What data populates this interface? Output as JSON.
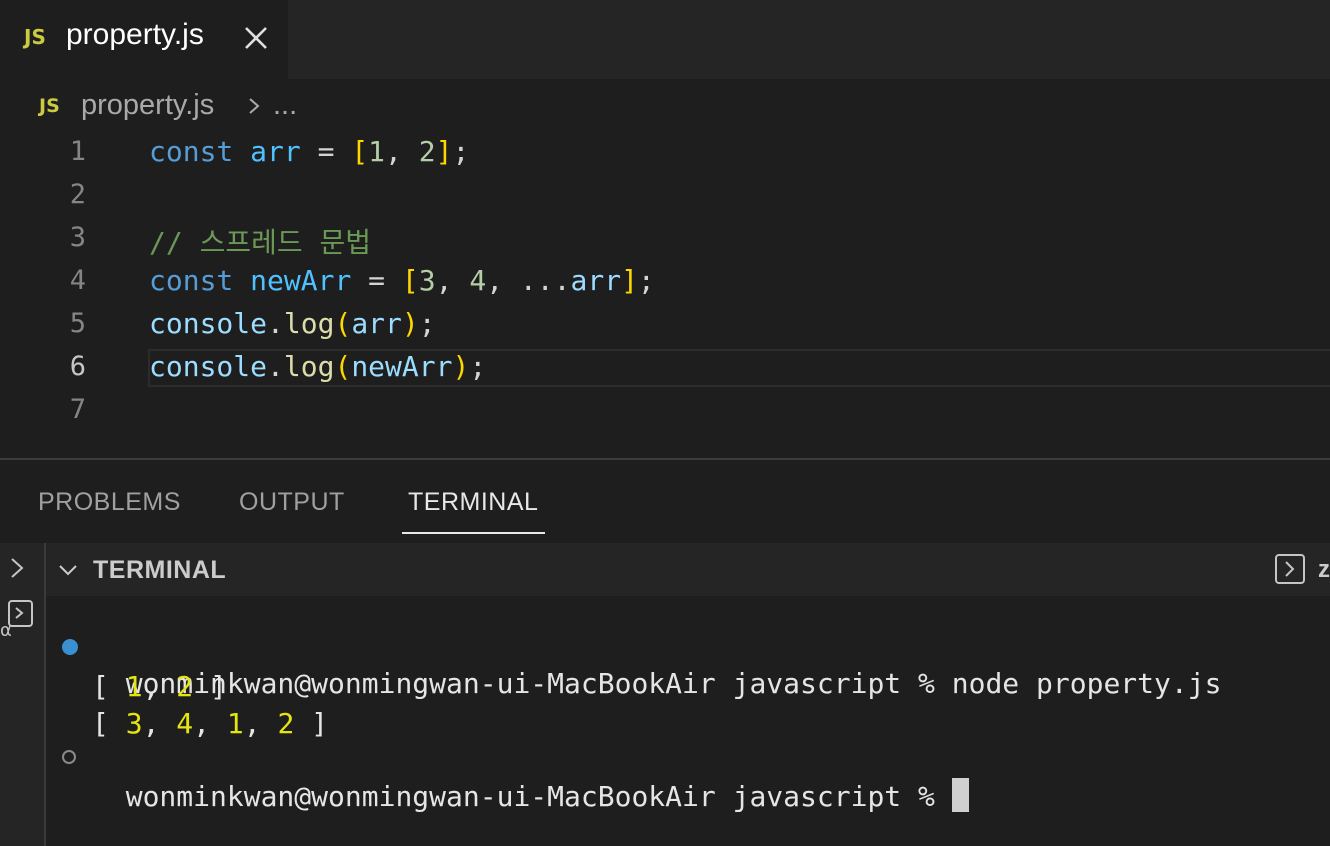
{
  "tab": {
    "badge": "JS",
    "label": "property.js",
    "close_icon": "close-icon"
  },
  "breadcrumb": {
    "badge": "JS",
    "file": "property.js",
    "ellipsis": "..."
  },
  "editor": {
    "active_line": 6,
    "lines": [
      {
        "number": "1",
        "tokens": [
          {
            "text": "const",
            "color": "#569cd6"
          },
          {
            "text": " ",
            "color": "#d4d4d4"
          },
          {
            "text": "arr",
            "color": "#4fc1ff"
          },
          {
            "text": " = ",
            "color": "#d4d4d4"
          },
          {
            "text": "[",
            "color": "#ffd700"
          },
          {
            "text": "1",
            "color": "#b5cea8"
          },
          {
            "text": ", ",
            "color": "#d4d4d4"
          },
          {
            "text": "2",
            "color": "#b5cea8"
          },
          {
            "text": "]",
            "color": "#ffd700"
          },
          {
            "text": ";",
            "color": "#d4d4d4"
          }
        ]
      },
      {
        "number": "2",
        "tokens": []
      },
      {
        "number": "3",
        "tokens": [
          {
            "text": "// 스프레드 문법",
            "color": "#6a9955"
          }
        ]
      },
      {
        "number": "4",
        "tokens": [
          {
            "text": "const",
            "color": "#569cd6"
          },
          {
            "text": " ",
            "color": "#d4d4d4"
          },
          {
            "text": "newArr",
            "color": "#4fc1ff"
          },
          {
            "text": " = ",
            "color": "#d4d4d4"
          },
          {
            "text": "[",
            "color": "#ffd700"
          },
          {
            "text": "3",
            "color": "#b5cea8"
          },
          {
            "text": ", ",
            "color": "#d4d4d4"
          },
          {
            "text": "4",
            "color": "#b5cea8"
          },
          {
            "text": ", ",
            "color": "#d4d4d4"
          },
          {
            "text": "...",
            "color": "#d4d4d4"
          },
          {
            "text": "arr",
            "color": "#9cdcfe"
          },
          {
            "text": "]",
            "color": "#ffd700"
          },
          {
            "text": ";",
            "color": "#d4d4d4"
          }
        ]
      },
      {
        "number": "5",
        "tokens": [
          {
            "text": "console",
            "color": "#9cdcfe"
          },
          {
            "text": ".",
            "color": "#d4d4d4"
          },
          {
            "text": "log",
            "color": "#dcdcaa"
          },
          {
            "text": "(",
            "color": "#ffd700"
          },
          {
            "text": "arr",
            "color": "#9cdcfe"
          },
          {
            "text": ")",
            "color": "#ffd700"
          },
          {
            "text": ";",
            "color": "#d4d4d4"
          }
        ]
      },
      {
        "number": "6",
        "tokens": [
          {
            "text": "console",
            "color": "#9cdcfe"
          },
          {
            "text": ".",
            "color": "#d4d4d4"
          },
          {
            "text": "log",
            "color": "#dcdcaa"
          },
          {
            "text": "(",
            "color": "#ffd700"
          },
          {
            "text": "newArr",
            "color": "#9cdcfe"
          },
          {
            "text": ")",
            "color": "#ffd700"
          },
          {
            "text": ";",
            "color": "#d4d4d4"
          }
        ]
      },
      {
        "number": "7",
        "tokens": []
      }
    ]
  },
  "panel": {
    "tabs": [
      {
        "label": "PROBLEMS",
        "active": false
      },
      {
        "label": "OUTPUT",
        "active": false
      },
      {
        "label": "TERMINAL",
        "active": true
      }
    ],
    "terminal_header": {
      "title": "TERMINAL",
      "partial_label": "z"
    },
    "terminal": {
      "prompt": "wonminkwan@wonmingwan-ui-MacBookAir javascript % ",
      "command": "node property.js",
      "output_lines": [
        [
          "[ ",
          "1",
          ", ",
          "2",
          " ]"
        ],
        [
          "[ ",
          "3",
          ", ",
          "4",
          ", ",
          "1",
          ", ",
          "2",
          " ]"
        ]
      ],
      "number_color": "#e5e510"
    }
  }
}
